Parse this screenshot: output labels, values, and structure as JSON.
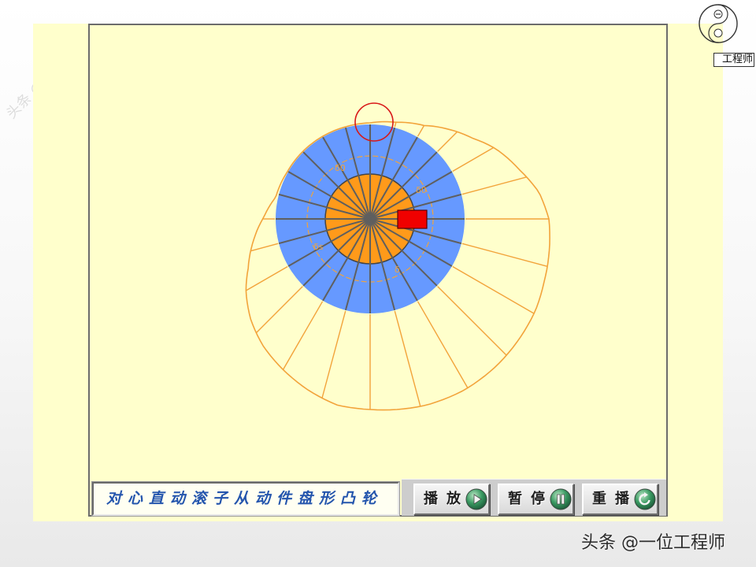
{
  "watermarks": {
    "corner_text": "头条 @一位工程师",
    "footer_text": "头条 @一位工程师"
  },
  "logo": {
    "caption": "工程师",
    "icon": "yin-yang-emblem-icon"
  },
  "diagram": {
    "angle_labels": [
      "δ0",
      "δ0",
      "δs",
      "δ"
    ],
    "colors": {
      "panel": "#FFFFCC",
      "cam_disc": "#6699FF",
      "hub": "#FF9A1A",
      "pitch_curve": "#F2A33A",
      "spokes": "#5F5F5F",
      "roller": "#D81818",
      "follower_block": "#F00000"
    }
  },
  "controls": {
    "title": "对心直动滚子从动件盘形凸轮",
    "buttons": [
      {
        "label": "播放",
        "icon": "play-icon"
      },
      {
        "label": "暂停",
        "icon": "pause-icon"
      },
      {
        "label": "重播",
        "icon": "replay-icon"
      }
    ]
  }
}
